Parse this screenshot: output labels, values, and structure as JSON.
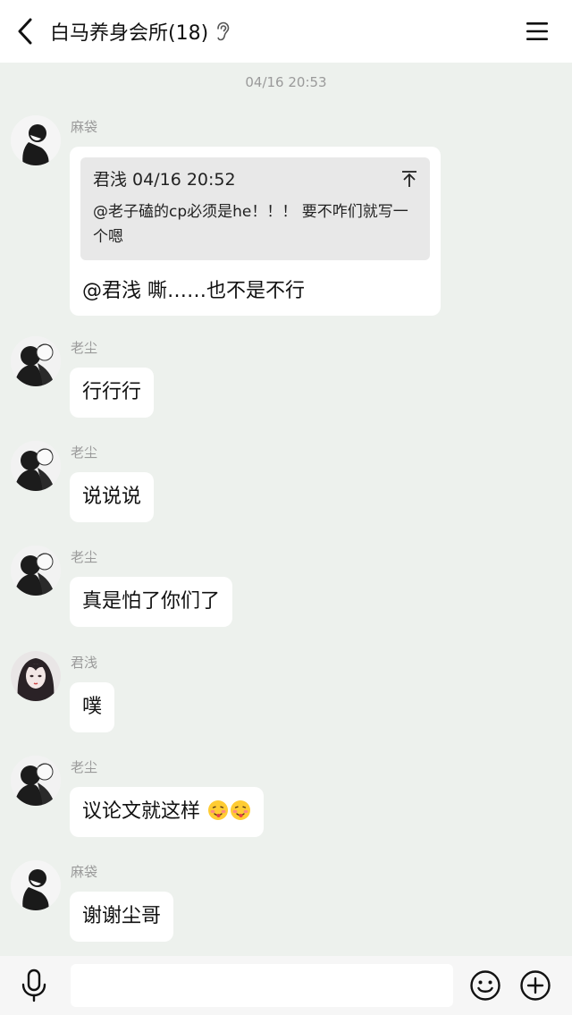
{
  "header": {
    "title": "白马养身会所(18)",
    "back_icon": "back-arrow-icon",
    "ear_icon": "ear-icon",
    "menu_icon": "hamburger-menu-icon"
  },
  "timestamp": "04/16 20:53",
  "messages": [
    {
      "sender": "麻袋",
      "avatar": "avatar-madai",
      "quote": {
        "header": "君浅 04/16 20:52",
        "body": "@老子磕的cp必须是he！！！ 要不咋们就写一个嗯"
      },
      "text": "@君浅 嘶……也不是不行"
    },
    {
      "sender": "老尘",
      "avatar": "avatar-laochen",
      "text": "行行行"
    },
    {
      "sender": "老尘",
      "avatar": "avatar-laochen",
      "text": "说说说"
    },
    {
      "sender": "老尘",
      "avatar": "avatar-laochen",
      "text": "真是怕了你们了"
    },
    {
      "sender": "君浅",
      "avatar": "avatar-junqian",
      "text": "噗"
    },
    {
      "sender": "老尘",
      "avatar": "avatar-laochen",
      "text": "议论文就这样",
      "emojis": [
        "savoring-face-emoji",
        "savoring-face-emoji"
      ]
    },
    {
      "sender": "麻袋",
      "avatar": "avatar-madai",
      "text": "谢谢尘哥"
    }
  ],
  "bottombar": {
    "input_value": "",
    "mic_icon": "microphone-icon",
    "emoji_icon": "smiley-icon",
    "plus_icon": "plus-circle-icon"
  },
  "colors": {
    "chat_background": "#edf1ed",
    "bubble": "#ffffff",
    "quote_background": "#e8e8e8",
    "meta_text": "#9a9a9a"
  }
}
